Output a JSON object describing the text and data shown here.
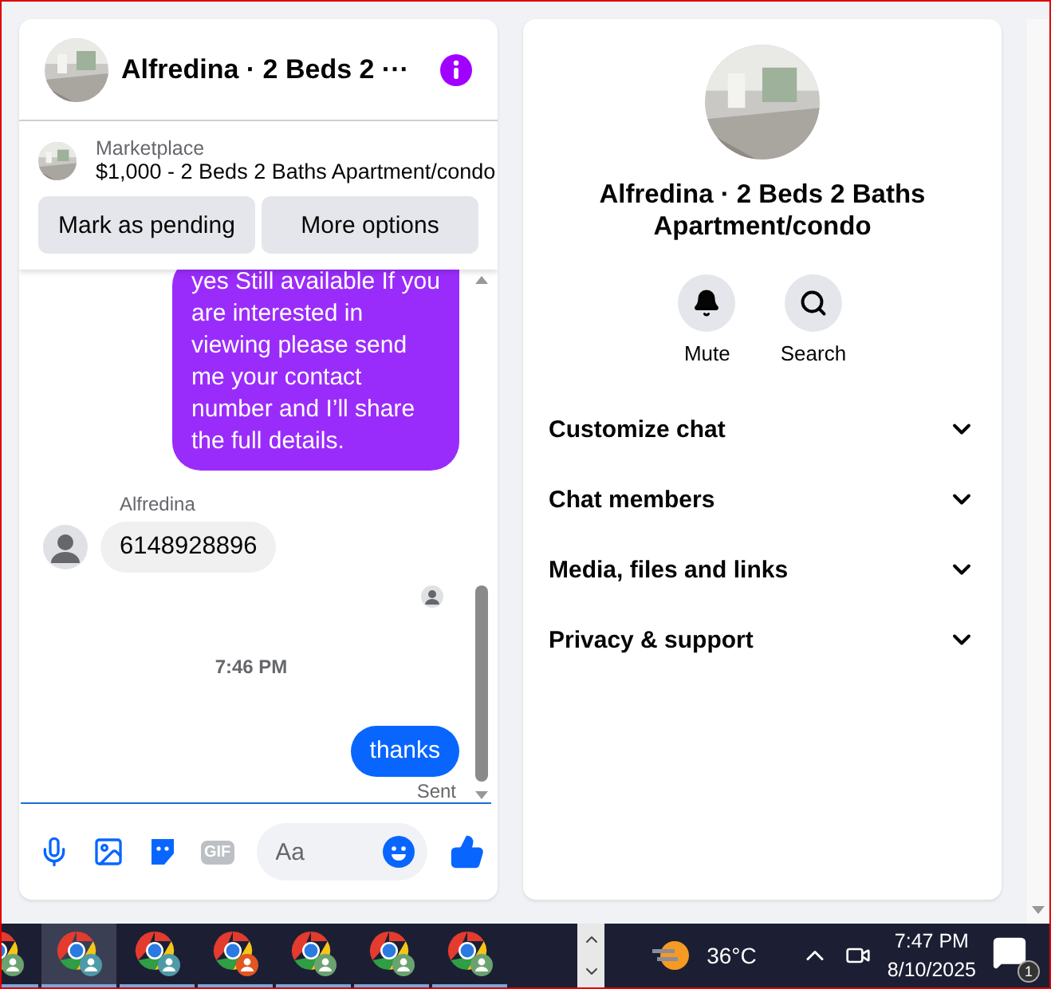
{
  "chat": {
    "title": "Alfredina · 2 Beds 2 ···",
    "listing": {
      "source": "Marketplace",
      "title": "$1,000 - 2 Beds 2 Baths Apartment/condo",
      "buttons": [
        "Mark as pending",
        "More options"
      ]
    },
    "messages": [
      {
        "kind": "outgoing",
        "text": "yes Still available If you are interested in viewing please send me your contact number and I’ll share the full details.",
        "color": "#9a2cfb"
      },
      {
        "kind": "incoming",
        "sender": "Alfredina",
        "text": "6148928896"
      },
      {
        "kind": "read_receipt"
      },
      {
        "kind": "timestamp",
        "text": "7:46 PM"
      },
      {
        "kind": "outgoing",
        "text": "thanks",
        "color": "#0866ff",
        "status": "Sent"
      }
    ],
    "composer": {
      "gif_label": "GIF",
      "placeholder": "Aa"
    }
  },
  "profile": {
    "name": "Alfredina · 2 Beds 2 Baths Apartment/condo",
    "actions": [
      {
        "kind": "bell",
        "label": "Mute"
      },
      {
        "kind": "search",
        "label": "Search"
      }
    ],
    "sections": [
      {
        "label": "Customize chat",
        "expanded": false
      },
      {
        "label": "Chat members",
        "expanded": false
      },
      {
        "label": "Media, files and links",
        "expanded": false
      },
      {
        "label": "Privacy & support",
        "expanded": false
      }
    ]
  },
  "taskbar": {
    "apps": [
      {
        "selected": false,
        "color": "#6aa36f"
      },
      {
        "selected": true,
        "color": "#4e9aa8"
      },
      {
        "selected": false,
        "color": "#4e9aa8"
      },
      {
        "selected": false,
        "color": "#e2561f"
      },
      {
        "selected": false,
        "color": "#6aa36f"
      },
      {
        "selected": false,
        "color": "#6aa36f"
      },
      {
        "selected": false,
        "color": "#6aa36f"
      }
    ],
    "temperature": "36°C",
    "time": "7:47 PM",
    "date": "8/10/2025",
    "notifications": "1"
  }
}
